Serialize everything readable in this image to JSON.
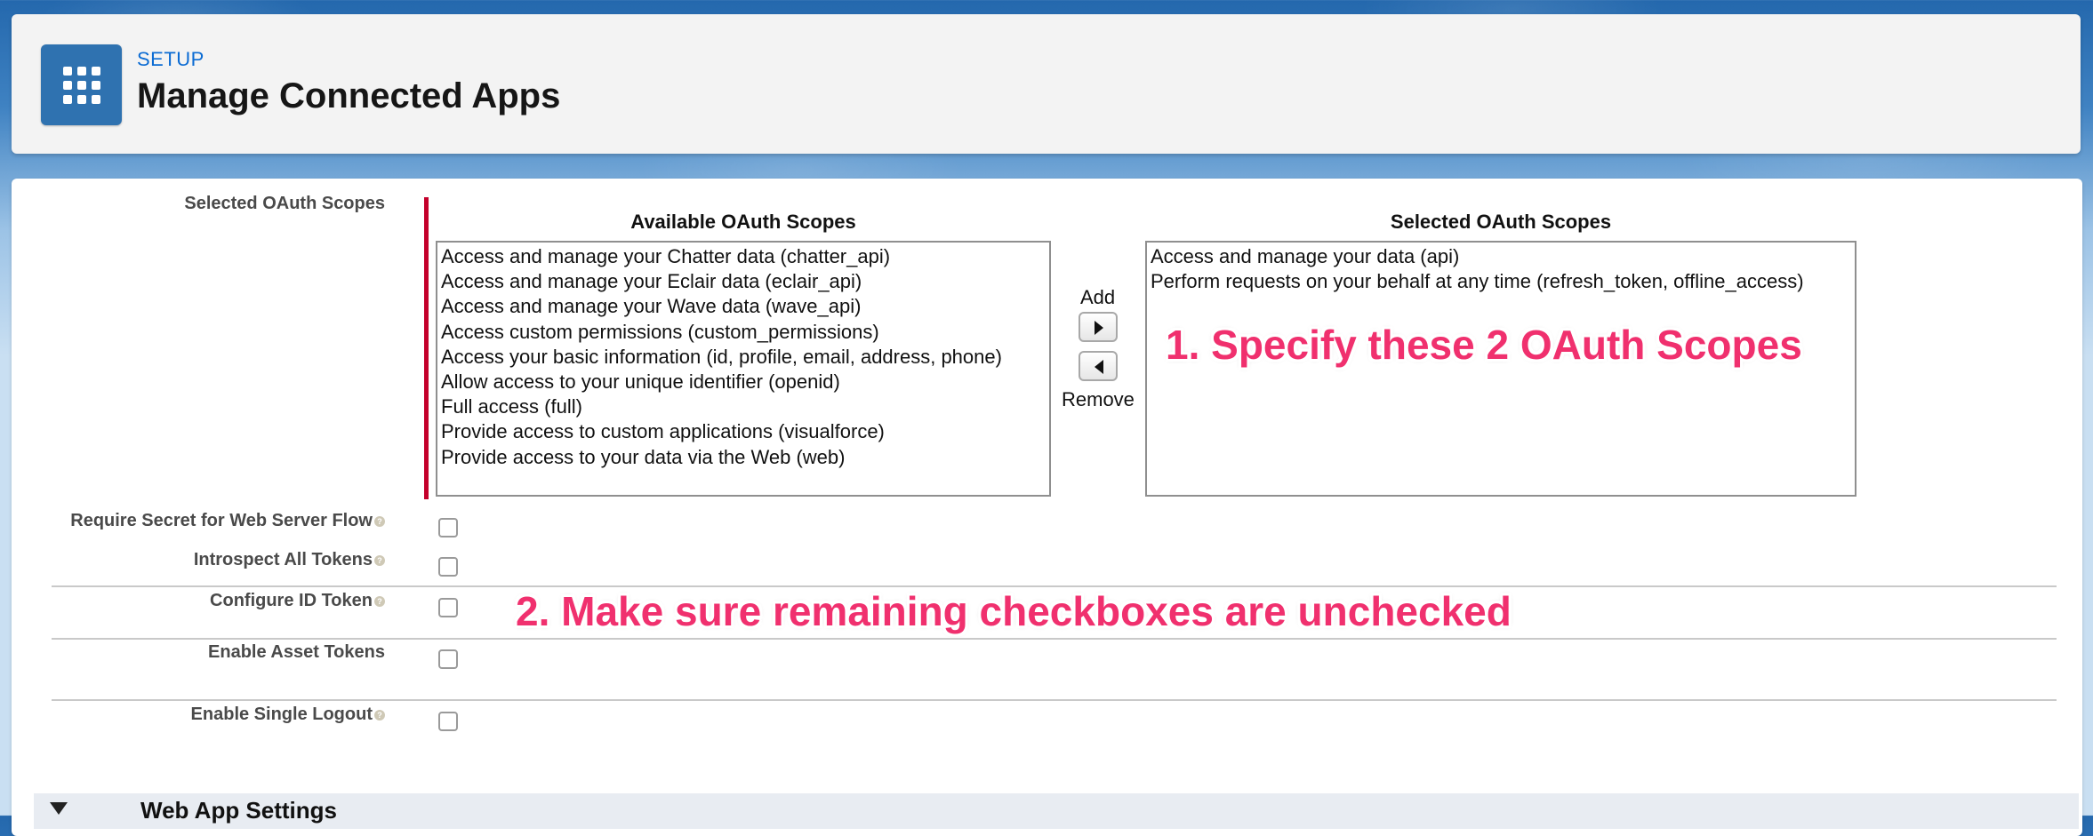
{
  "header": {
    "setup_label": "SETUP",
    "title": "Manage Connected Apps"
  },
  "oauth": {
    "field_label": "Selected OAuth Scopes",
    "available_heading": "Available OAuth Scopes",
    "selected_heading": "Selected OAuth Scopes",
    "available": [
      "Access and manage your Chatter data (chatter_api)",
      "Access and manage your Eclair data (eclair_api)",
      "Access and manage your Wave data (wave_api)",
      "Access custom permissions (custom_permissions)",
      "Access your basic information (id, profile, email, address, phone)",
      "Allow access to your unique identifier (openid)",
      "Full access (full)",
      "Provide access to custom applications (visualforce)",
      "Provide access to your data via the Web (web)"
    ],
    "selected": [
      "Access and manage your data (api)",
      "Perform requests on your behalf at any time (refresh_token, offline_access)"
    ],
    "add_label": "Add",
    "remove_label": "Remove"
  },
  "checkboxes": [
    {
      "label": "Require Secret for Web Server Flow",
      "checked": false,
      "help": true
    },
    {
      "label": "Introspect All Tokens",
      "checked": false,
      "help": true
    },
    {
      "label": "Configure ID Token",
      "checked": false,
      "help": true
    },
    {
      "label": "Enable Asset Tokens",
      "checked": false,
      "help": false
    },
    {
      "label": "Enable Single Logout",
      "checked": false,
      "help": true
    }
  ],
  "annotations": {
    "step1": "1. Specify these 2 OAuth Scopes",
    "step2": "2. Make sure remaining checkboxes are unchecked"
  },
  "section": {
    "title": "Web App Settings"
  },
  "colors": {
    "accent": "#f0306e",
    "required": "#c4002b",
    "tile": "#2f72b0",
    "link": "#0b6bd3"
  }
}
